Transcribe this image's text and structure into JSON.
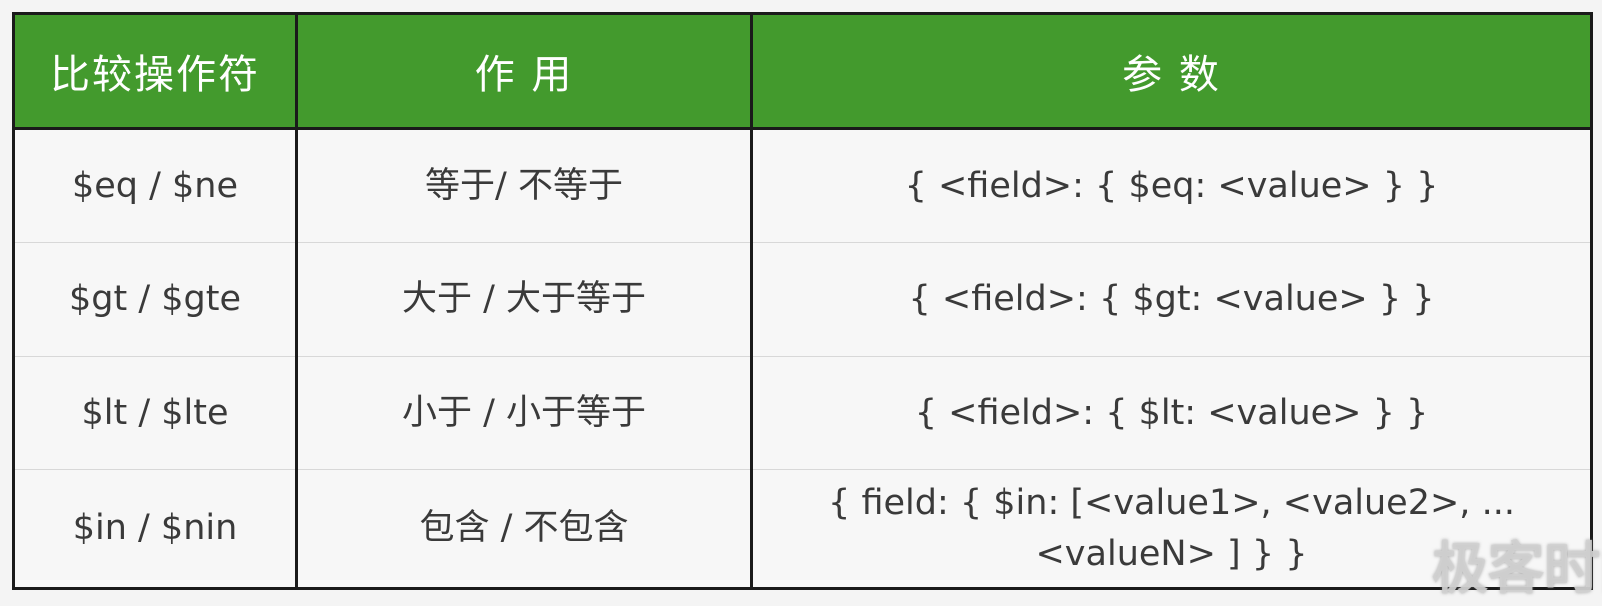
{
  "table": {
    "headers": [
      "比较操作符",
      "作 用",
      "参 数"
    ],
    "rows": [
      {
        "op": "$eq / $ne",
        "desc": "等于/ 不等于",
        "param": "{  <field>: { $eq: <value> }  }"
      },
      {
        "op": "$gt / $gte",
        "desc": "大于 /  大于等于",
        "param": "{  <field>: { $gt: <value> }  }"
      },
      {
        "op": "$lt / $lte",
        "desc": "小于 /  小于等于",
        "param": "{  <field>: { $lt: <value> }  }"
      },
      {
        "op": "$in / $nin",
        "desc": "包含 / 不包含",
        "param": "{ field: { $in: [<value1>, <value2>, ... <valueN> ] } }"
      }
    ]
  },
  "watermark": "极客时间",
  "colors": {
    "header_bg": "#439a2d",
    "header_text": "#ffffff",
    "cell_text": "#3a3a3a",
    "border": "#1a1a1a"
  }
}
